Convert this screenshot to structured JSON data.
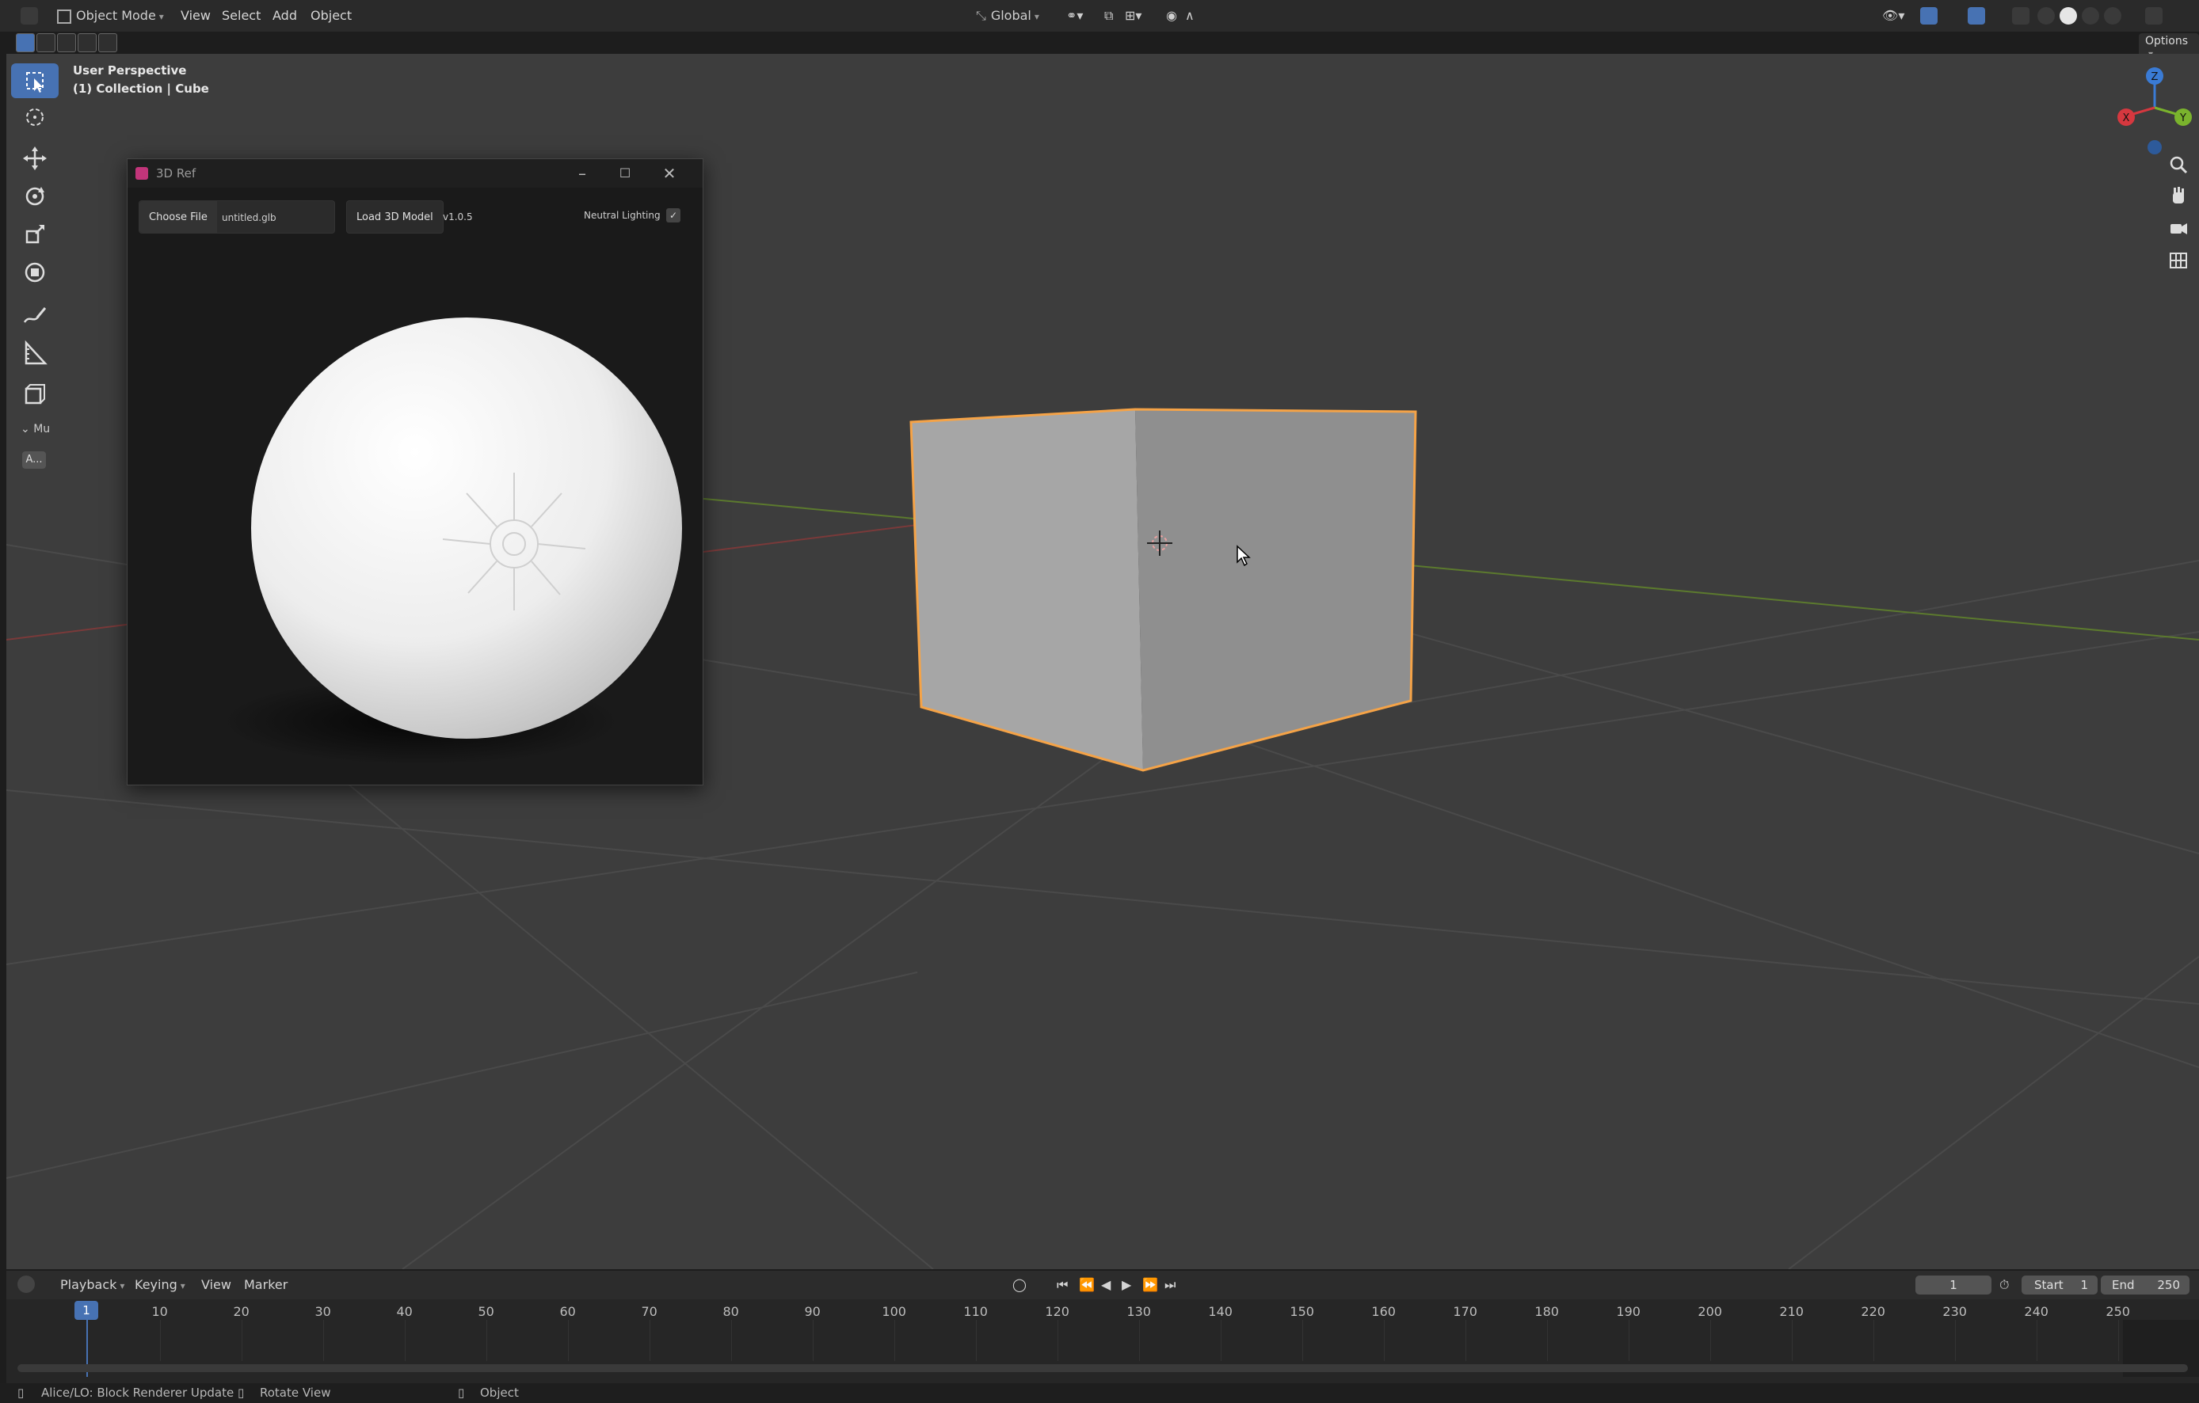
{
  "header": {
    "mode": "Object Mode",
    "menus": [
      "View",
      "Select",
      "Add",
      "Object"
    ],
    "orientation": "Global",
    "options_label": "Options"
  },
  "viewport": {
    "perspective": "User Perspective",
    "collection": "(1) Collection | Cube",
    "sidebar_tab": "Mu",
    "sidebar_btn": "A...",
    "gizmo": {
      "z": "Z",
      "y": "Y",
      "x": "X"
    },
    "selection_color": "#f5a347"
  },
  "ref_window": {
    "title": "3D Ref",
    "choose_file": "Choose File",
    "file_name": "untitled.glb",
    "load_button": "Load 3D Model",
    "version": "v1.0.5",
    "neutral_lighting": "Neutral Lighting",
    "neutral_checked": true
  },
  "timeline": {
    "menus": [
      "Playback",
      "Keying",
      "View",
      "Marker"
    ],
    "current_frame": "1",
    "start_label": "Start",
    "start_value": "1",
    "end_label": "End",
    "end_value": "250",
    "ruler": [
      "10",
      "20",
      "30",
      "40",
      "50",
      "60",
      "70",
      "80",
      "90",
      "100",
      "110",
      "120",
      "130",
      "140",
      "150",
      "160",
      "170",
      "180",
      "190",
      "200",
      "210",
      "220",
      "230",
      "240",
      "250"
    ],
    "playhead": "1"
  },
  "status": {
    "left": "Alice/LO: Block Renderer Update",
    "middle": "Rotate View",
    "right": "Object"
  }
}
